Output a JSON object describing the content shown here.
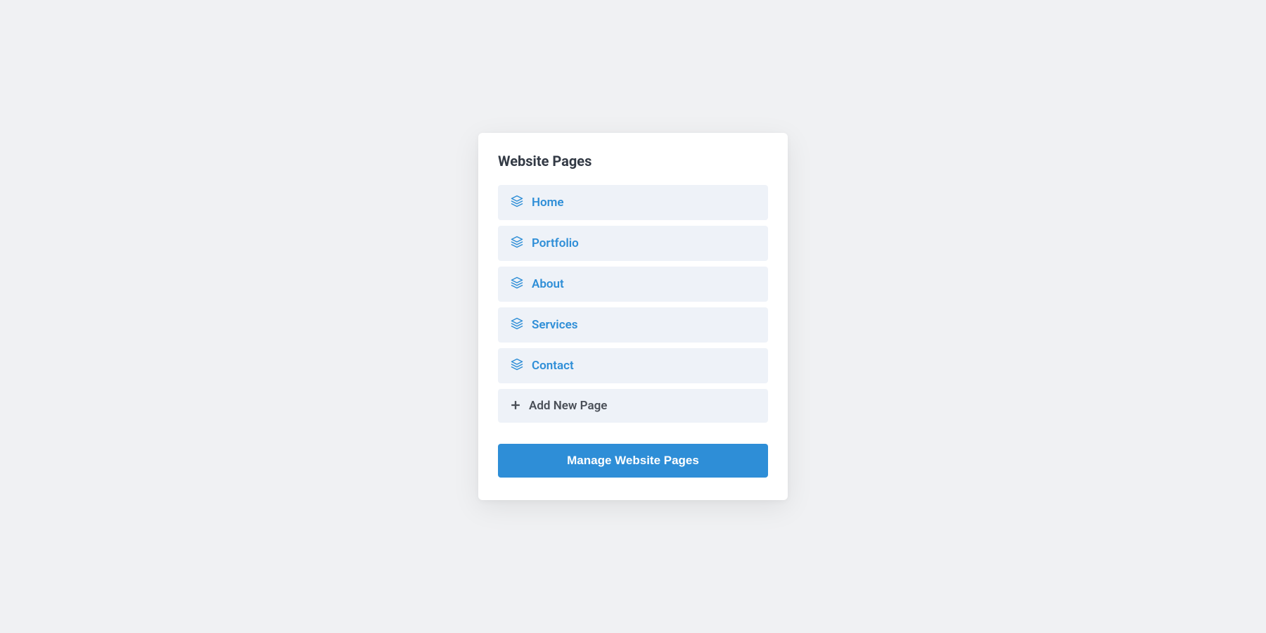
{
  "card": {
    "title": "Website Pages",
    "pages": [
      {
        "label": "Home"
      },
      {
        "label": "Portfolio"
      },
      {
        "label": "About"
      },
      {
        "label": "Services"
      },
      {
        "label": "Contact"
      }
    ],
    "add_new_label": "Add New Page",
    "manage_button_label": "Manage Website Pages"
  },
  "colors": {
    "accent": "#2e8ed7",
    "item_bg": "#eef2f8",
    "text_dark": "#333a45",
    "text_muted": "#4a4f57",
    "page_bg": "#f0f1f3"
  }
}
